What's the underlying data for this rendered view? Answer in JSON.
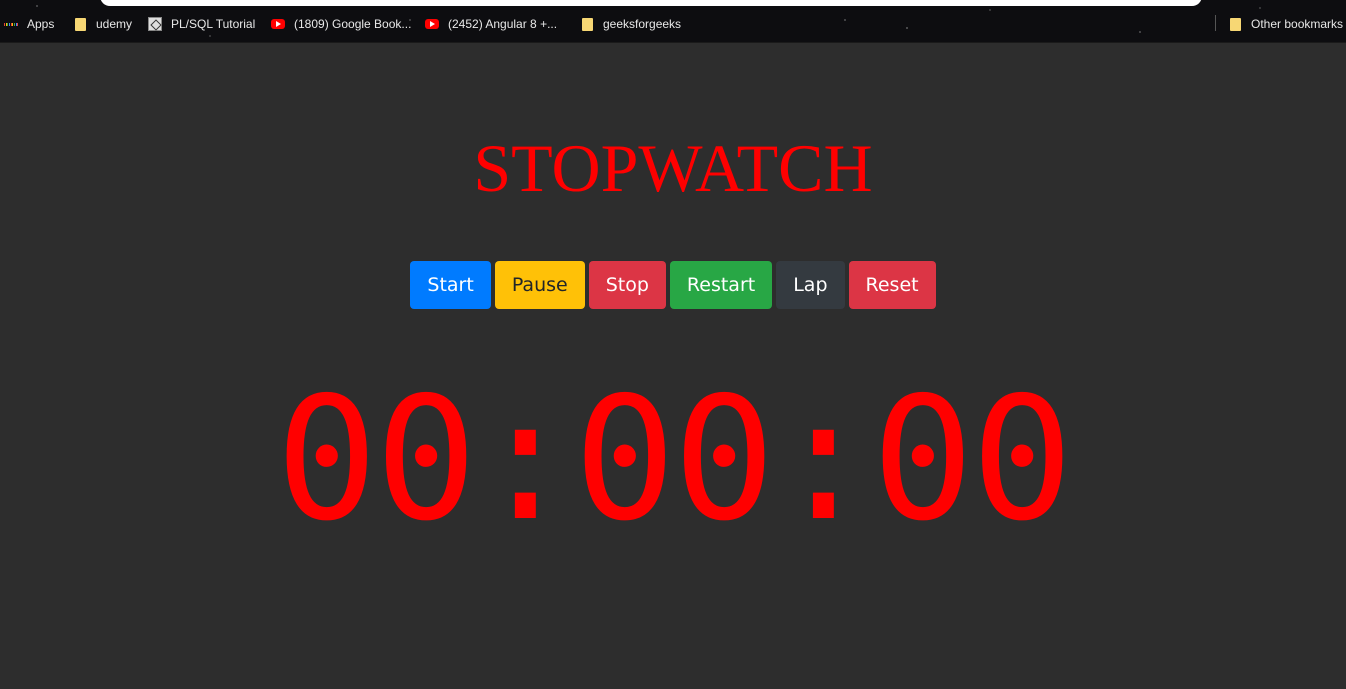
{
  "bookmarks": {
    "apps_label": "Apps",
    "items": [
      {
        "label": "udemy",
        "icon": "folder-icon"
      },
      {
        "label": "PL/SQL Tutorial",
        "icon": "site-icon"
      },
      {
        "label": "(1809) Google Book...",
        "icon": "youtube-icon"
      },
      {
        "label": "(2452) Angular 8 +...",
        "icon": "youtube-icon"
      },
      {
        "label": "geeksforgeeks",
        "icon": "folder-icon"
      }
    ],
    "other_label": "Other bookmarks"
  },
  "page": {
    "title": "STOPWATCH",
    "buttons": {
      "start": "Start",
      "pause": "Pause",
      "stop": "Stop",
      "restart": "Restart",
      "lap": "Lap",
      "reset": "Reset"
    },
    "time": "00:00:00"
  },
  "colors": {
    "background": "#2d2d2d",
    "accent": "#ff0000",
    "start": "#007bff",
    "pause": "#ffc107",
    "stop": "#dc3545",
    "restart": "#28a745",
    "lap": "#343a40",
    "reset": "#dc3545"
  }
}
